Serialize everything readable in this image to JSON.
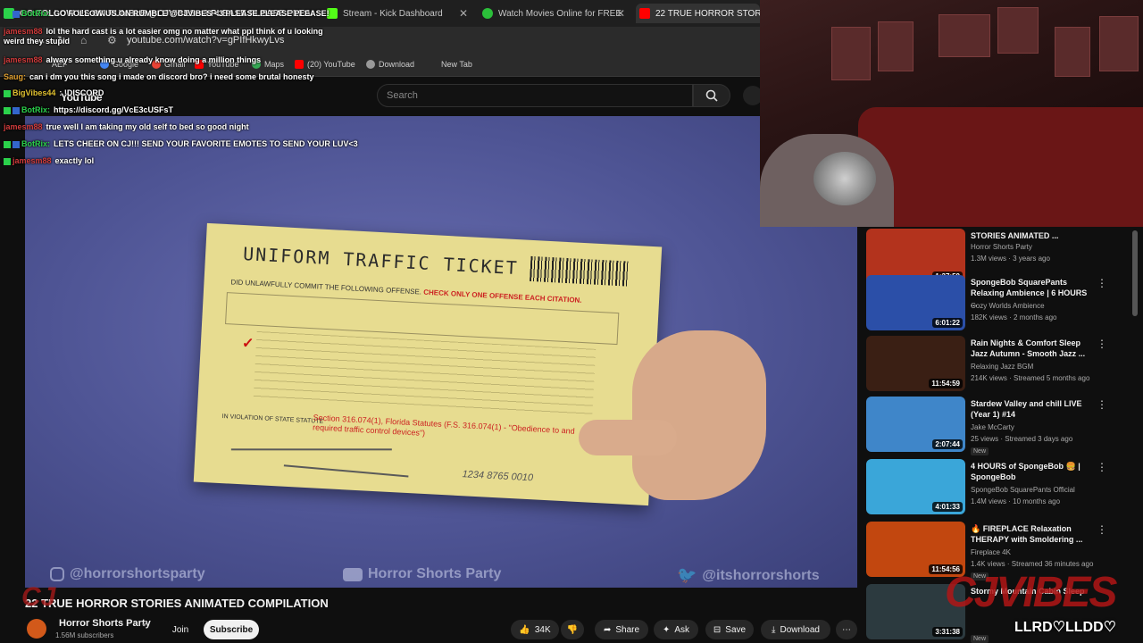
{
  "browser": {
    "tabs": [
      {
        "label": "GO FOLLOW US ON RUMBLE @CJVIBES <3 PLEASE PLEASE PLEASE!",
        "color": "#2bd14b"
      },
      {
        "label": "Stream - Kick Dashboard",
        "color": "#53fc18"
      },
      {
        "label": "Watch Movies Online for FREE",
        "color": "#2bbf3a"
      },
      {
        "label": "22 TRUE HORROR STORIES",
        "color": "#ff0000"
      }
    ],
    "url": "youtube.com/watch?v=gPIfHkwyLvs",
    "bookmarks": [
      "AEF",
      "Google",
      "Gmail",
      "YouTube",
      "Maps",
      "(20) YouTube",
      "Download",
      "New Tab"
    ]
  },
  "youtube": {
    "logo": "YouTube",
    "search_placeholder": "Search"
  },
  "chat": [
    {
      "user": "BotRix:",
      "text": "GO FOLLOW US ON RUMBLE @CJVIBES <3 PLEASE PLEASE PLEASE!",
      "user_color": "#2bd14b"
    },
    {
      "user": "jamesm88",
      "text": "lol the hard cast is a lot easier omg no matter what ppl think of u looking weird they stupid",
      "user_color": "#d23c3c"
    },
    {
      "user": "jamesm88",
      "text": "always something u already know doing a million things",
      "user_color": "#d23c3c"
    },
    {
      "user": "Saug:",
      "text": "can i dm you this song i made on discord bro? i need some brutal honesty",
      "user_color": "#e0a030"
    },
    {
      "user": "BigVibes44",
      "text": ": !DISCORD",
      "user_color": "#e0c030"
    },
    {
      "user": "BotRix:",
      "text": "https://discord.gg/VcE3cUSFsT",
      "user_color": "#2bd14b"
    },
    {
      "user": "jamesm88",
      "text": "true well I am taking my old self to bed so good night",
      "user_color": "#d23c3c"
    },
    {
      "user": "BotRix:",
      "text": "LETS CHEER ON CJ!!! SEND YOUR FAVORITE EMOTES TO SEND YOUR LUV<3",
      "user_color": "#2bd14b"
    },
    {
      "user": "jamesm88",
      "text": "exactly lol",
      "user_color": "#d23c3c"
    }
  ],
  "ticket": {
    "title": "UNIFORM TRAFFIC TICKET",
    "offense_line": "DID UNLAWFULLY COMMIT THE FOLLOWING OFFENSE.",
    "offense_red": "CHECK ONLY ONE OFFENSE EACH CITATION.",
    "statute_label": "IN VIOLATION OF STATE STATUTE",
    "statute_text": "Section 316.074(1), Florida Statutes (F.S. 316.074(1) - \"Obedience to and required traffic control devices\")",
    "number": "1234 8765 0010"
  },
  "watermarks": {
    "instagram": "@horrorshortsparty",
    "youtube": "Horror Shorts Party",
    "twitter": "@itshorrorshorts"
  },
  "video": {
    "title": "22 TRUE HORROR STORIES ANIMATED COMPILATION",
    "channel": "Horror Shorts Party",
    "subscribers": "1.56M subscribers",
    "join": "Join",
    "subscribe": "Subscribe",
    "likes": "34K",
    "share": "Share",
    "ask": "Ask",
    "save": "Save",
    "download": "Download"
  },
  "overlay": {
    "cj": "CJ",
    "ghoul": "CJVIBES",
    "llrd": "LLRD♡LLDD♡"
  },
  "sidebar": [
    {
      "title": "STORIES ANIMATED ...",
      "channel": "Horror Shorts Party",
      "meta": "1.3M views · 3 years ago",
      "duration": "1:37:59",
      "new": "",
      "bg": "#b3331d"
    },
    {
      "title": "SpongeBob SquarePants Relaxing Ambience | 6 HOURS ...",
      "channel": "Cozy Worlds Ambience",
      "meta": "182K views · 2 months ago",
      "duration": "6:01:22",
      "new": "",
      "bg": "#2b4fa8"
    },
    {
      "title": "Rain Nights & Comfort Sleep Jazz Autumn - Smooth Jazz ...",
      "channel": "Relaxing Jazz BGM",
      "meta": "214K views · Streamed 5 months ago",
      "duration": "11:54:59",
      "new": "",
      "bg": "#3a1f14"
    },
    {
      "title": "Stardew Valley and chill LIVE (Year 1) #14",
      "channel": "Jake McCarty",
      "meta": "25 views · Streamed 3 days ago",
      "duration": "2:07:44",
      "new": "New",
      "bg": "#3f86c9"
    },
    {
      "title": "4 HOURS of SpongeBob 🍔 | SpongeBob",
      "channel": "SpongeBob SquarePants Official",
      "meta": "1.4M views · 10 months ago",
      "duration": "4:01:33",
      "new": "",
      "bg": "#3aa6d9"
    },
    {
      "title": "🔥 FIREPLACE Relaxation THERAPY with Smoldering ...",
      "channel": "Fireplace 4K",
      "meta": "1.4K views · Streamed 36 minutes ago",
      "duration": "11:54:56",
      "new": "New",
      "bg": "#c2470f"
    },
    {
      "title": "Stormy Mountain Cabin Sleep",
      "channel": "",
      "meta": "",
      "duration": "3:31:38",
      "new": "New",
      "bg": "#2c3a3f"
    }
  ],
  "colors": {
    "background": "#0f0f0f",
    "accent_red": "#ff0000",
    "kick_green": "#53fc18"
  }
}
